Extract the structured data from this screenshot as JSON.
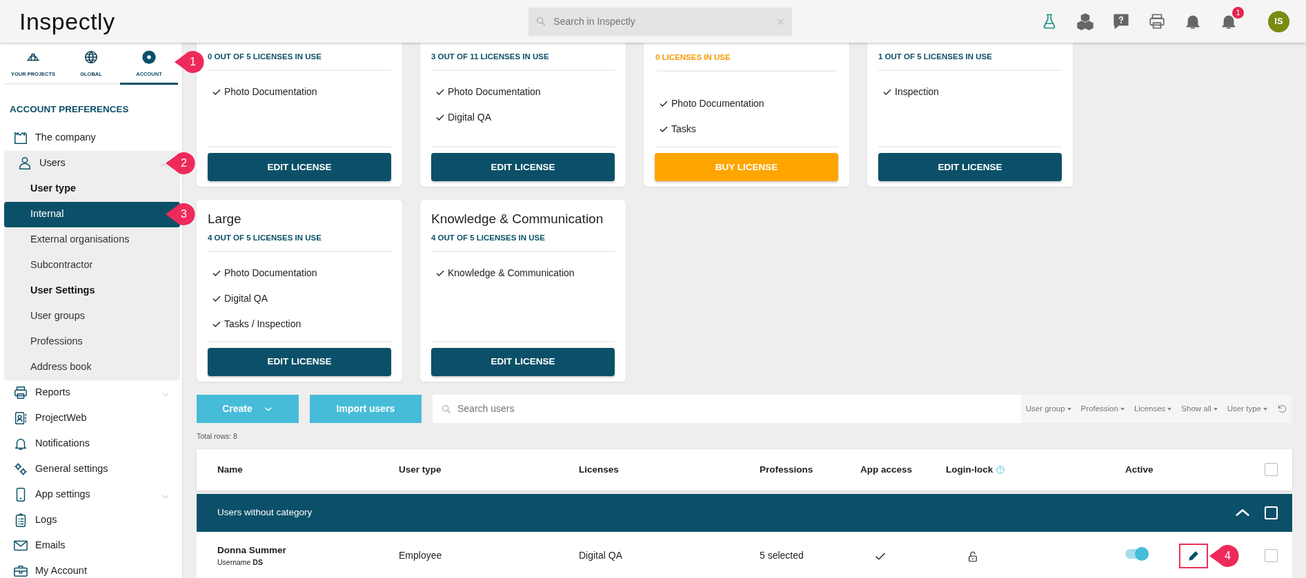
{
  "header": {
    "logo": "Inspectly",
    "search": {
      "placeholder": "Search in Inspectly"
    },
    "notification_badge": "1",
    "avatar_initials": "IS"
  },
  "sidebar": {
    "tabs": [
      {
        "label": "YOUR PROJECTS",
        "selected": false
      },
      {
        "label": "GLOBAL",
        "selected": false
      },
      {
        "label": "ACCOUNT",
        "selected": true,
        "callout": "1"
      }
    ],
    "section_title": "ACCOUNT PREFERENCES",
    "items": [
      {
        "label": "The company",
        "kind": "link",
        "selected": false
      },
      {
        "label": "Users",
        "kind": "group",
        "expanded": true,
        "callout": "2",
        "children": [
          {
            "label": "User type",
            "kind": "heading"
          },
          {
            "label": "Internal",
            "kind": "link",
            "selected": true,
            "callout": "3"
          },
          {
            "label": "External organisations",
            "kind": "link",
            "selected": false
          },
          {
            "label": "Subcontractor",
            "kind": "link",
            "selected": false
          },
          {
            "label": "User Settings",
            "kind": "heading"
          },
          {
            "label": "User groups",
            "kind": "link",
            "selected": false
          },
          {
            "label": "Professions",
            "kind": "link",
            "selected": false
          },
          {
            "label": "Address book",
            "kind": "link",
            "selected": false
          }
        ]
      },
      {
        "label": "Reports",
        "kind": "group",
        "expanded": false
      },
      {
        "label": "ProjectWeb",
        "kind": "link",
        "selected": false
      },
      {
        "label": "Notifications",
        "kind": "link",
        "selected": false
      },
      {
        "label": "General settings",
        "kind": "link",
        "selected": false
      },
      {
        "label": "App settings",
        "kind": "group",
        "expanded": false
      },
      {
        "label": "Logs",
        "kind": "link",
        "selected": false
      },
      {
        "label": "Emails",
        "kind": "link",
        "selected": false
      },
      {
        "label": "My Account",
        "kind": "link",
        "selected": false
      }
    ]
  },
  "license_cards": [
    {
      "usage": "0 OUT OF 5 LICENSES IN USE",
      "usage_alert": false,
      "features": [
        "Photo Documentation"
      ],
      "button": {
        "label": "EDIT LICENSE",
        "kind": "primary"
      }
    },
    {
      "usage": "3 OUT OF 11 LICENSES IN USE",
      "usage_alert": false,
      "features": [
        "Photo Documentation",
        "Digital QA"
      ],
      "button": {
        "label": "EDIT LICENSE",
        "kind": "primary"
      }
    },
    {
      "usage": "0 LICENSES IN USE",
      "usage_alert": true,
      "features": [
        "Photo Documentation",
        "Tasks"
      ],
      "button": {
        "label": "BUY LICENSE",
        "kind": "warning"
      }
    },
    {
      "usage": "1 OUT OF 5 LICENSES IN USE",
      "usage_alert": false,
      "features": [
        "Inspection"
      ],
      "button": {
        "label": "EDIT LICENSE",
        "kind": "primary"
      }
    },
    {
      "title": "Large",
      "usage": "4 OUT OF 5 LICENSES IN USE",
      "usage_alert": false,
      "features": [
        "Photo Documentation",
        "Digital QA",
        "Tasks / Inspection"
      ],
      "button": {
        "label": "EDIT LICENSE",
        "kind": "primary"
      }
    },
    {
      "title": "Knowledge & Communication",
      "usage": "4 OUT OF 5 LICENSES IN USE",
      "usage_alert": false,
      "features": [
        "Knowledge & Communication"
      ],
      "button": {
        "label": "EDIT LICENSE",
        "kind": "primary"
      }
    }
  ],
  "toolbar": {
    "create_button": "Create",
    "import_button": "Import users",
    "search": {
      "placeholder": "Search users"
    },
    "filters": [
      "User group",
      "Profession",
      "Licenses",
      "Show all",
      "User type"
    ]
  },
  "total_rows": "Total rows: 8",
  "table": {
    "columns": [
      "Name",
      "User type",
      "Licenses",
      "Professions",
      "App access",
      "Login-lock",
      "Active"
    ],
    "select_all_checked": false,
    "groups": [
      {
        "label": "Users without category",
        "expanded": true,
        "checked": false,
        "rows": [
          {
            "name": "Donna Summer",
            "username": "Username **DS**",
            "user_type": "Employee",
            "licenses": "Digital QA",
            "professions": "5 selected",
            "app_access": true,
            "login_locked": false,
            "active": true,
            "checked": false,
            "edit_highlighted": true,
            "callout": "4"
          }
        ]
      }
    ]
  }
}
